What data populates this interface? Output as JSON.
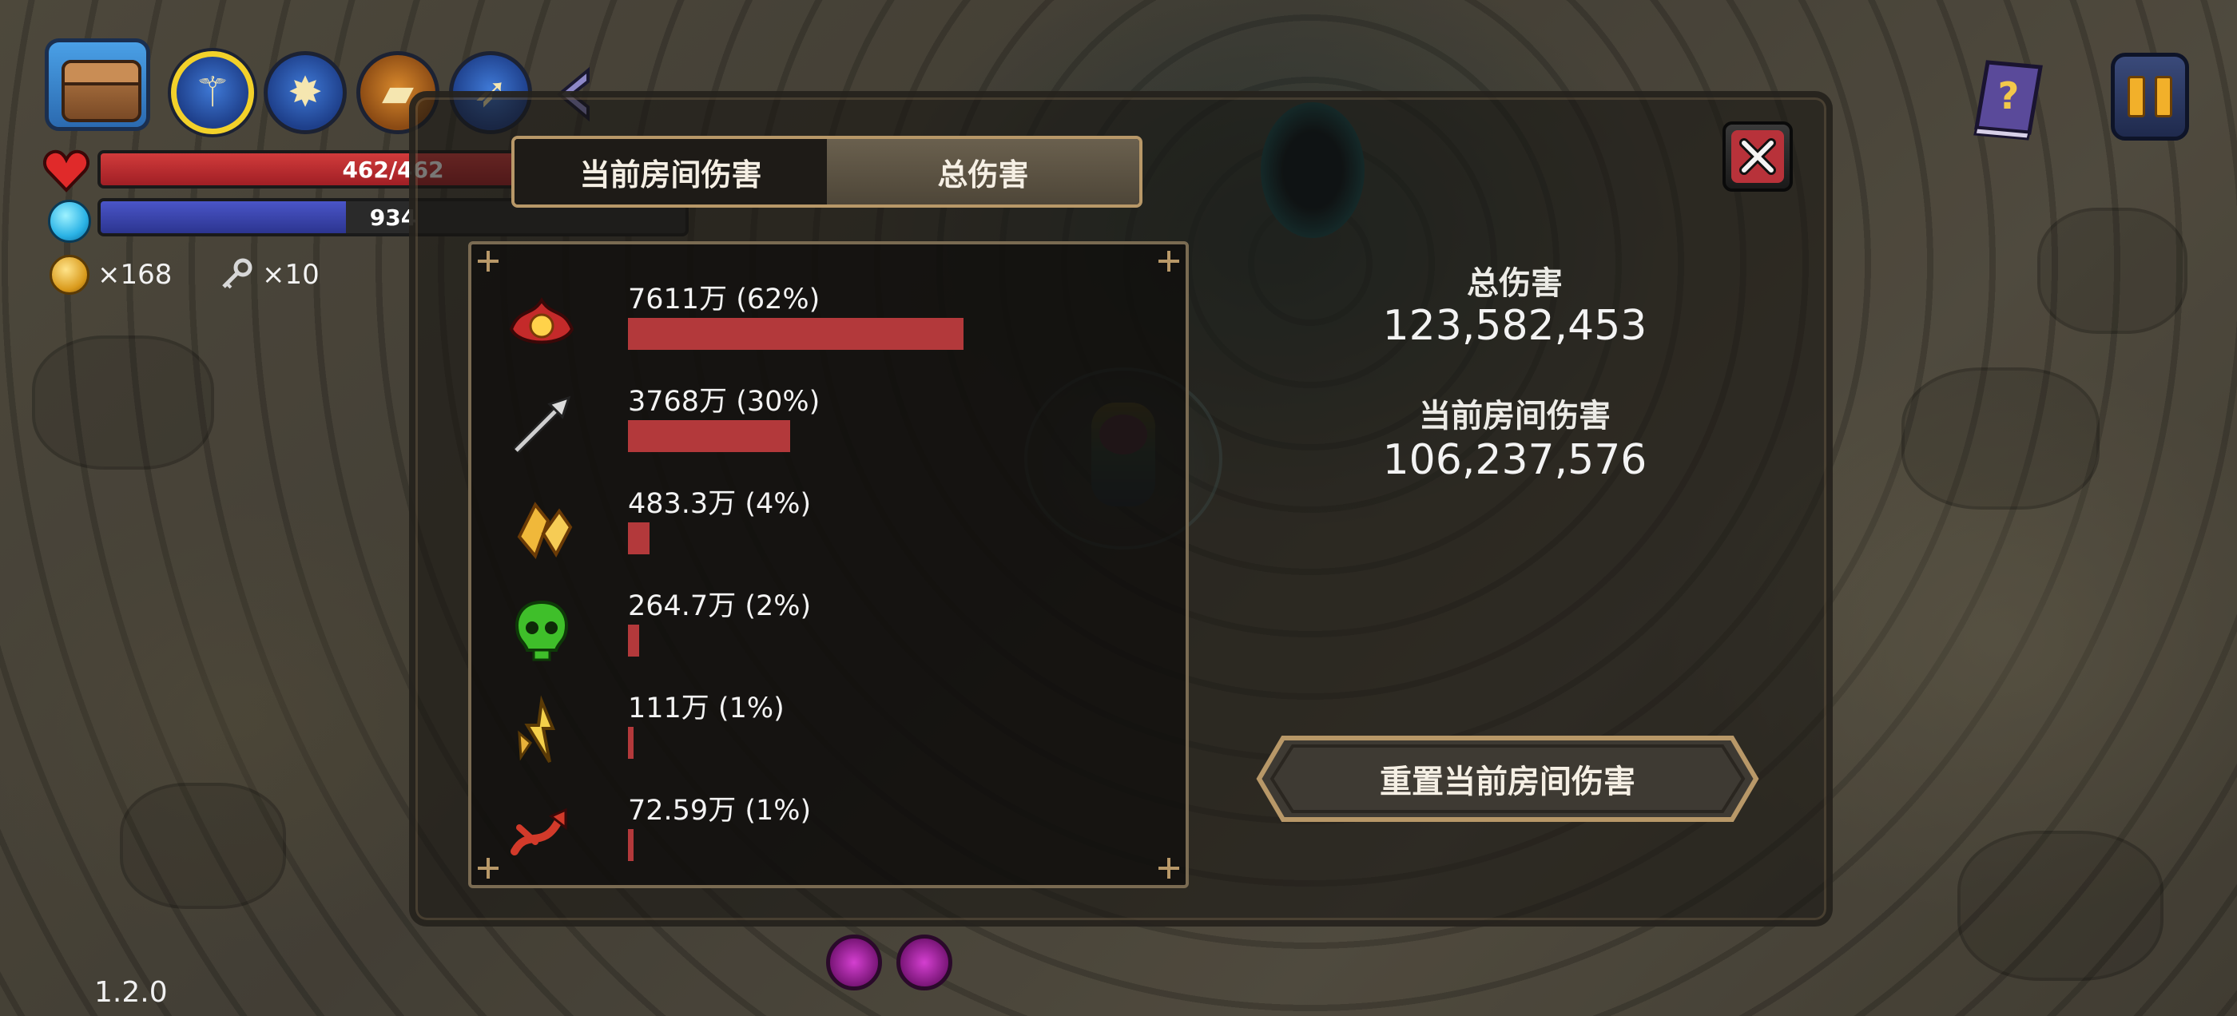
{
  "hud": {
    "hp_text": "462/462",
    "hp_fraction": 1.0,
    "mp_text": "934",
    "mp_fraction": 0.42,
    "coins": "×168",
    "keys": "×10",
    "version": "1.2.0",
    "skills": [
      "staff-icon",
      "mace-icon",
      "spellbook-icon",
      "spear-icon"
    ]
  },
  "panel": {
    "tabs": {
      "current_room": "当前房间伤害",
      "total": "总伤害",
      "selected": "total"
    },
    "damage_rows": [
      {
        "icon": "fire-flower-icon",
        "label": "7611万 (62%)",
        "fraction": 0.62
      },
      {
        "icon": "arrow-icon",
        "label": "3768万 (30%)",
        "fraction": 0.3
      },
      {
        "icon": "crystal-icon",
        "label": "483.3万 (4%)",
        "fraction": 0.04
      },
      {
        "icon": "poison-skull-icon",
        "label": "264.7万 (2%)",
        "fraction": 0.02
      },
      {
        "icon": "lightning-shard-icon",
        "label": "111万 (1%)",
        "fraction": 0.01
      },
      {
        "icon": "red-arrows-icon",
        "label": "72.59万 (1%)",
        "fraction": 0.01
      }
    ],
    "total_damage_title": "总伤害",
    "total_damage_value": "123,582,453",
    "current_room_title": "当前房间伤害",
    "current_room_value": "106,237,576",
    "reset_button": "重置当前房间伤害"
  },
  "colors": {
    "damage_bar": "#b3393b",
    "tab_border": "#b89868",
    "close_red": "#b8323a"
  }
}
